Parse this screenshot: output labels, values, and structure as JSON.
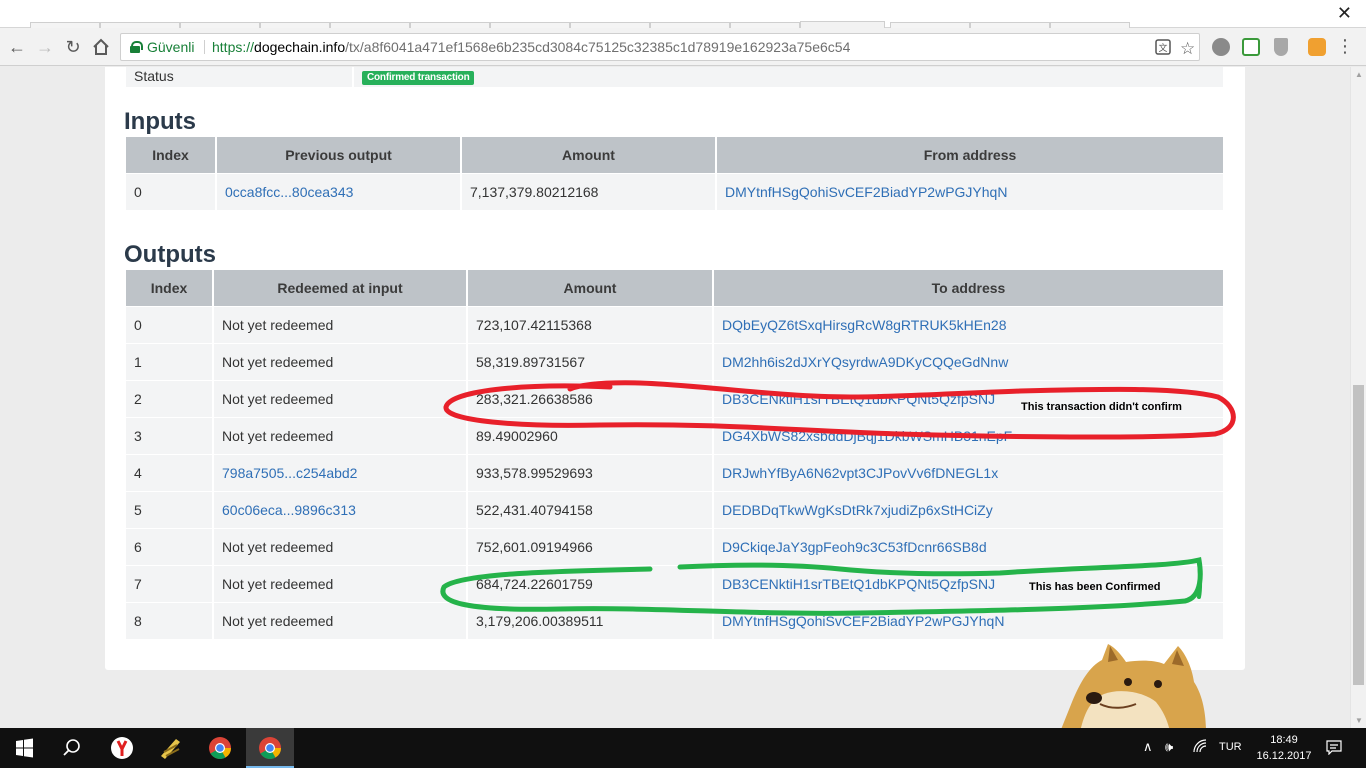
{
  "browser": {
    "secure_label": "Güvenli",
    "url_scheme": "https://",
    "url_host": "dogechain.info",
    "url_path": "/tx/a8f6041a471ef1568e6b235cd3084c75125c32385c1d78919e162923a75e6c54"
  },
  "status": {
    "label": "Status",
    "badge": "Confirmed transaction"
  },
  "inputs": {
    "title": "Inputs",
    "headers": [
      "Index",
      "Previous output",
      "Amount",
      "From address"
    ],
    "rows": [
      {
        "index": "0",
        "previous_output": "0cca8fcc...80cea343",
        "amount": "7,137,379.80212168",
        "from_address": "DMYtnfHSgQohiSvCEF2BiadYP2wPGJYhqN"
      }
    ]
  },
  "outputs": {
    "title": "Outputs",
    "headers": [
      "Index",
      "Redeemed at input",
      "Amount",
      "To address"
    ],
    "rows": [
      {
        "index": "0",
        "redeemed": "Not yet redeemed",
        "redeemed_link": false,
        "amount": "723,107.42115368",
        "to_address": "DQbEyQZ6tSxqHirsgRcW8gRTRUK5kHEn28"
      },
      {
        "index": "1",
        "redeemed": "Not yet redeemed",
        "redeemed_link": false,
        "amount": "58,319.89731567",
        "to_address": "DM2hh6is2dJXrYQsyrdwA9DKyCQQeGdNnw"
      },
      {
        "index": "2",
        "redeemed": "Not yet redeemed",
        "redeemed_link": false,
        "amount": "283,321.26638586",
        "to_address": "DB3CENktiH1srTBEtQ1dbKPQNt5QzfpSNJ"
      },
      {
        "index": "3",
        "redeemed": "Not yet redeemed",
        "redeemed_link": false,
        "amount": "89.49002960",
        "to_address": "DG4XbWS82xsbddDjBqj1DkbWSmHB31nEpF"
      },
      {
        "index": "4",
        "redeemed": "798a7505...c254abd2",
        "redeemed_link": true,
        "amount": "933,578.99529693",
        "to_address": "DRJwhYfByA6N62vpt3CJPovVv6fDNEGL1x"
      },
      {
        "index": "5",
        "redeemed": "60c06eca...9896c313",
        "redeemed_link": true,
        "amount": "522,431.40794158",
        "to_address": "DEDBDqTkwWgKsDtRk7xjudiZp6xStHCiZy"
      },
      {
        "index": "6",
        "redeemed": "Not yet redeemed",
        "redeemed_link": false,
        "amount": "752,601.09194966",
        "to_address": "D9CkiqeJaY3gpFeoh9c3C53fDcnr66SB8d"
      },
      {
        "index": "7",
        "redeemed": "Not yet redeemed",
        "redeemed_link": false,
        "amount": "684,724.22601759",
        "to_address": "DB3CENktiH1srTBEtQ1dbKPQNt5QzfpSNJ"
      },
      {
        "index": "8",
        "redeemed": "Not yet redeemed",
        "redeemed_link": false,
        "amount": "3,179,206.00389511",
        "to_address": "DMYtnfHSgQohiSvCEF2BiadYP2wPGJYhqN"
      }
    ]
  },
  "annotations": {
    "red_note": "This transaction didn't confirm",
    "red_color": "#e8202a",
    "green_note": "This has been Confirmed",
    "green_color": "#25b34a"
  },
  "taskbar": {
    "language": "TUR",
    "time": "18:49",
    "date": "16.12.2017"
  },
  "colors": {
    "link": "#2f6fb6",
    "badge": "#27b05a",
    "header_bg": "#bec3c8",
    "row_bg": "#f3f4f5"
  }
}
